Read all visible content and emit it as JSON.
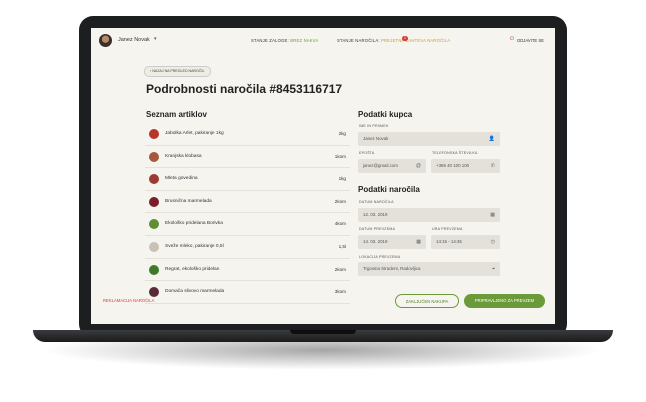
{
  "header": {
    "user_name": "Janez Novak",
    "stock_label": "STANJE ZALOGE:",
    "stock_value": "BREZ NAKVA",
    "order_status_label": "STANJE NAROČILA:",
    "order_status_value": "PREJETNA ZAHTEVA NAROČILA",
    "order_badge": "1",
    "logout_label": "ODJAVITE SE"
  },
  "back_label": "‹  NAZAJ NA PREGLED NAROČIL",
  "page_title": "Podrobnosti naročila #8453116717",
  "items_heading": "Seznam artiklov",
  "items": [
    {
      "name": "Jabolka Arlet, pakiranje 1kg",
      "qty": "2kg",
      "color": "#b8352a"
    },
    {
      "name": "Kranjska klobasa",
      "qty": "1kom",
      "color": "#a4583d"
    },
    {
      "name": "Mleta govedina",
      "qty": "1kg",
      "color": "#9b3b34"
    },
    {
      "name": "Brusnična marmelada",
      "qty": "2kom",
      "color": "#7a1f2a"
    },
    {
      "name": "Ekološko pridelana Borivka",
      "qty": "4kom",
      "color": "#5f8c34"
    },
    {
      "name": "Sveže mleko, pakiranje 0,5l",
      "qty": "1,5l",
      "color": "#c8c2b5"
    },
    {
      "name": "Regrat, ekološko pridelan",
      "qty": "2kom",
      "color": "#3f7a2a"
    },
    {
      "name": "Domača slivovo marmelada",
      "qty": "3kom",
      "color": "#5b2a3a"
    }
  ],
  "buyer": {
    "heading": "Podatki kupca",
    "name_label": "IME IN PRIIMEK",
    "name_value": "Janez Novak",
    "email_label": "EPOŠTA",
    "email_value": "janez@gmail.com",
    "phone_label": "TELEFONSKA ŠTEVILKA",
    "phone_value": "+386 40 100 100"
  },
  "order": {
    "heading": "Podatki naročila",
    "date_label": "DATUM NAROČILA",
    "date_value": "12. 03. 2019",
    "pickup_date_label": "DATUM PREVZEMA",
    "pickup_date_value": "14. 03. 2019",
    "pickup_time_label": "URA PREVZEMA",
    "pickup_time_value": "14:15 - 14:45",
    "location_label": "LOKACIJA PREVZEMA",
    "location_value": "Trgovina Stradent, Radovljica"
  },
  "actions": {
    "complaint_label": "REKLAMACIJA NAROČILA",
    "close_label": "ZAKLJUČEN NAKUPA",
    "ready_label": "PRIPRAVLJENO ZA PREVZEM"
  },
  "colors": {
    "accent": "#6b9a3a",
    "danger": "#d93a3a",
    "background": "#f6f4ee"
  }
}
